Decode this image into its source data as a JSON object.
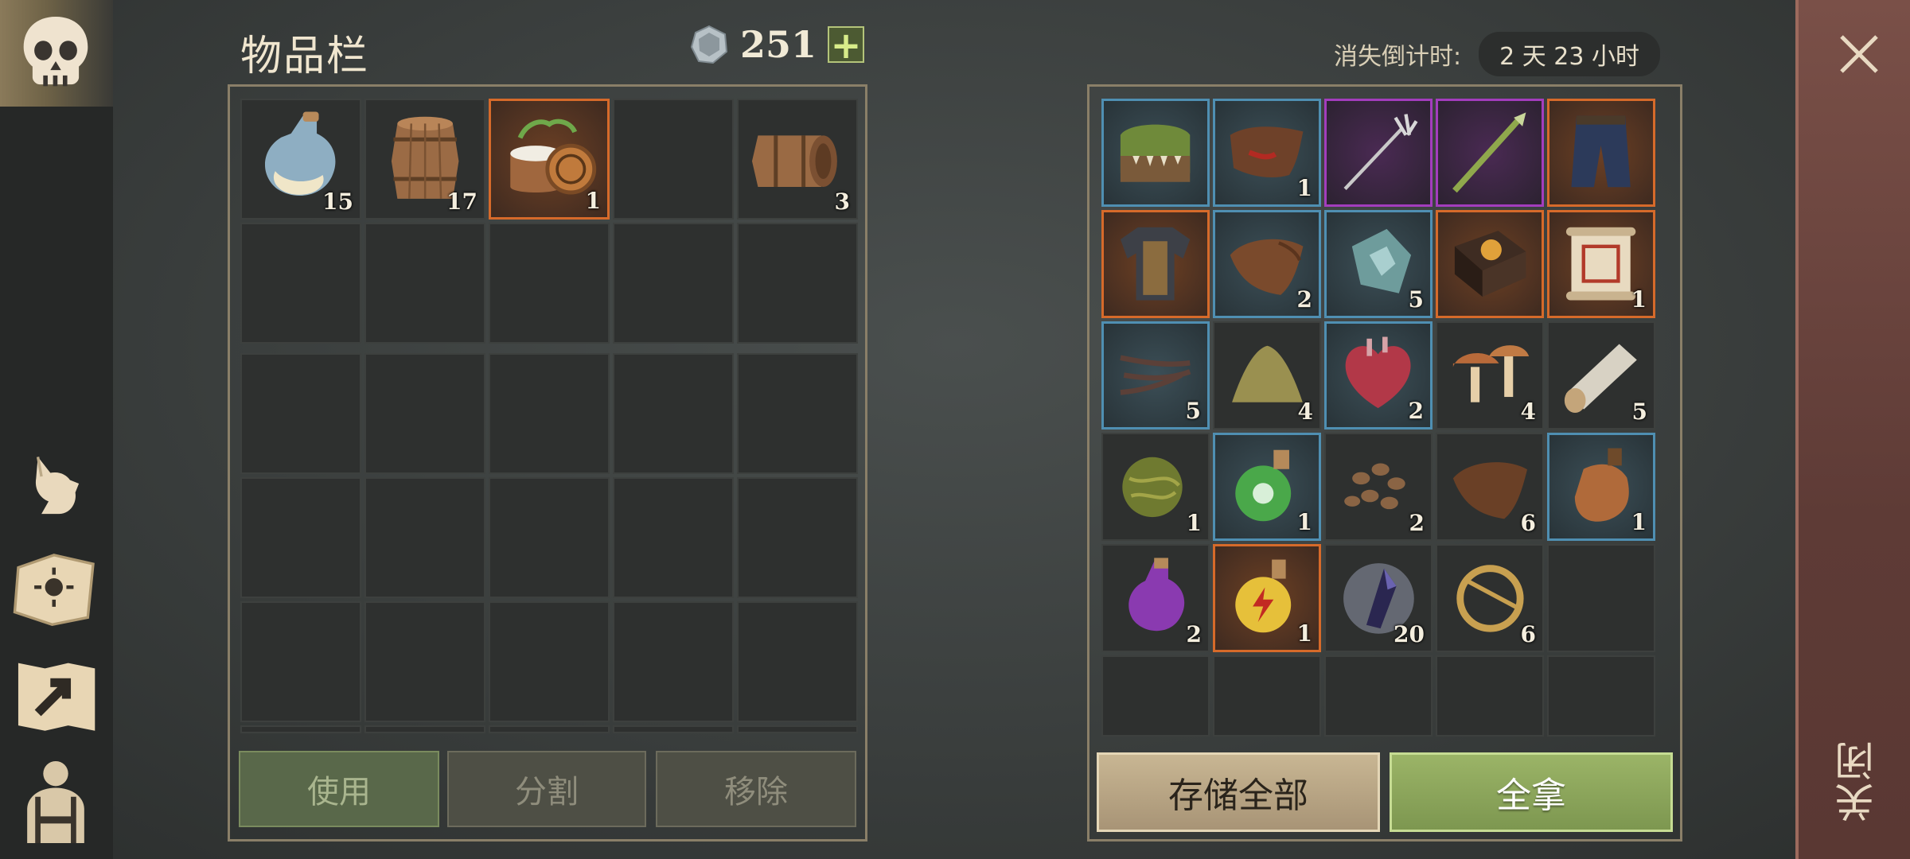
{
  "nav": {
    "items": [
      "skull-icon",
      "cat-icon",
      "sun-book-icon",
      "map-arrow-icon",
      "character-icon"
    ]
  },
  "inventory": {
    "title": "物品栏",
    "currency_amount": "251",
    "currency_plus": "+",
    "slots": [
      {
        "icon": "potion-flask-icon",
        "count": "15"
      },
      {
        "icon": "wooden-barrel-icon",
        "count": "17"
      },
      {
        "icon": "ointment-jar-icon",
        "count": "1",
        "rarity": "orange"
      },
      {
        "icon": "empty",
        "count": ""
      },
      {
        "icon": "lying-barrel-icon",
        "count": "3"
      }
    ],
    "buttons": {
      "use": "使用",
      "split": "分割",
      "remove": "移除"
    }
  },
  "container": {
    "countdown_label": "消失倒计时:",
    "countdown_value": "2 天 23 小时",
    "items": [
      {
        "icon": "mossy-chest-icon",
        "count": "",
        "rarity": "blue"
      },
      {
        "icon": "bloody-leather-icon",
        "count": "1",
        "rarity": "blue"
      },
      {
        "icon": "trident-icon",
        "count": "",
        "rarity": "purple"
      },
      {
        "icon": "green-spear-icon",
        "count": "",
        "rarity": "purple"
      },
      {
        "icon": "pants-icon",
        "count": "",
        "rarity": "orange"
      },
      {
        "icon": "armor-icon",
        "count": "",
        "rarity": "orange"
      },
      {
        "icon": "leather-icon",
        "count": "2",
        "rarity": "blue"
      },
      {
        "icon": "crystal-shard-icon",
        "count": "5",
        "rarity": "blue"
      },
      {
        "icon": "book-icon",
        "count": "",
        "rarity": "orange"
      },
      {
        "icon": "scroll-icon",
        "count": "1",
        "rarity": "orange"
      },
      {
        "icon": "claws-icon",
        "count": "5",
        "rarity": "blue"
      },
      {
        "icon": "powder-pile-icon",
        "count": "4",
        "rarity": ""
      },
      {
        "icon": "heart-icon",
        "count": "2",
        "rarity": "blue"
      },
      {
        "icon": "mushroom-icon",
        "count": "4",
        "rarity": ""
      },
      {
        "icon": "log-icon",
        "count": "5",
        "rarity": ""
      },
      {
        "icon": "herb-ball-icon",
        "count": "1",
        "rarity": ""
      },
      {
        "icon": "green-potion-icon",
        "count": "1",
        "rarity": "blue"
      },
      {
        "icon": "beans-icon",
        "count": "2",
        "rarity": ""
      },
      {
        "icon": "leather-icon",
        "count": "6",
        "rarity": ""
      },
      {
        "icon": "canteen-icon",
        "count": "1",
        "rarity": "blue"
      },
      {
        "icon": "purple-potion-icon",
        "count": "2",
        "rarity": ""
      },
      {
        "icon": "lightning-potion-icon",
        "count": "1",
        "rarity": "orange"
      },
      {
        "icon": "dark-crystal-icon",
        "count": "20",
        "rarity": ""
      },
      {
        "icon": "brooch-icon",
        "count": "6",
        "rarity": ""
      },
      {
        "icon": "empty",
        "count": "",
        "rarity": ""
      }
    ],
    "buttons": {
      "store_all": "存储全部",
      "take_all": "全拿"
    }
  },
  "close": {
    "label": "关闭"
  },
  "colors": {
    "rarity_blue": "#4f8fb2",
    "rarity_orange": "#d66a2a",
    "rarity_purple": "#a33dbd"
  }
}
